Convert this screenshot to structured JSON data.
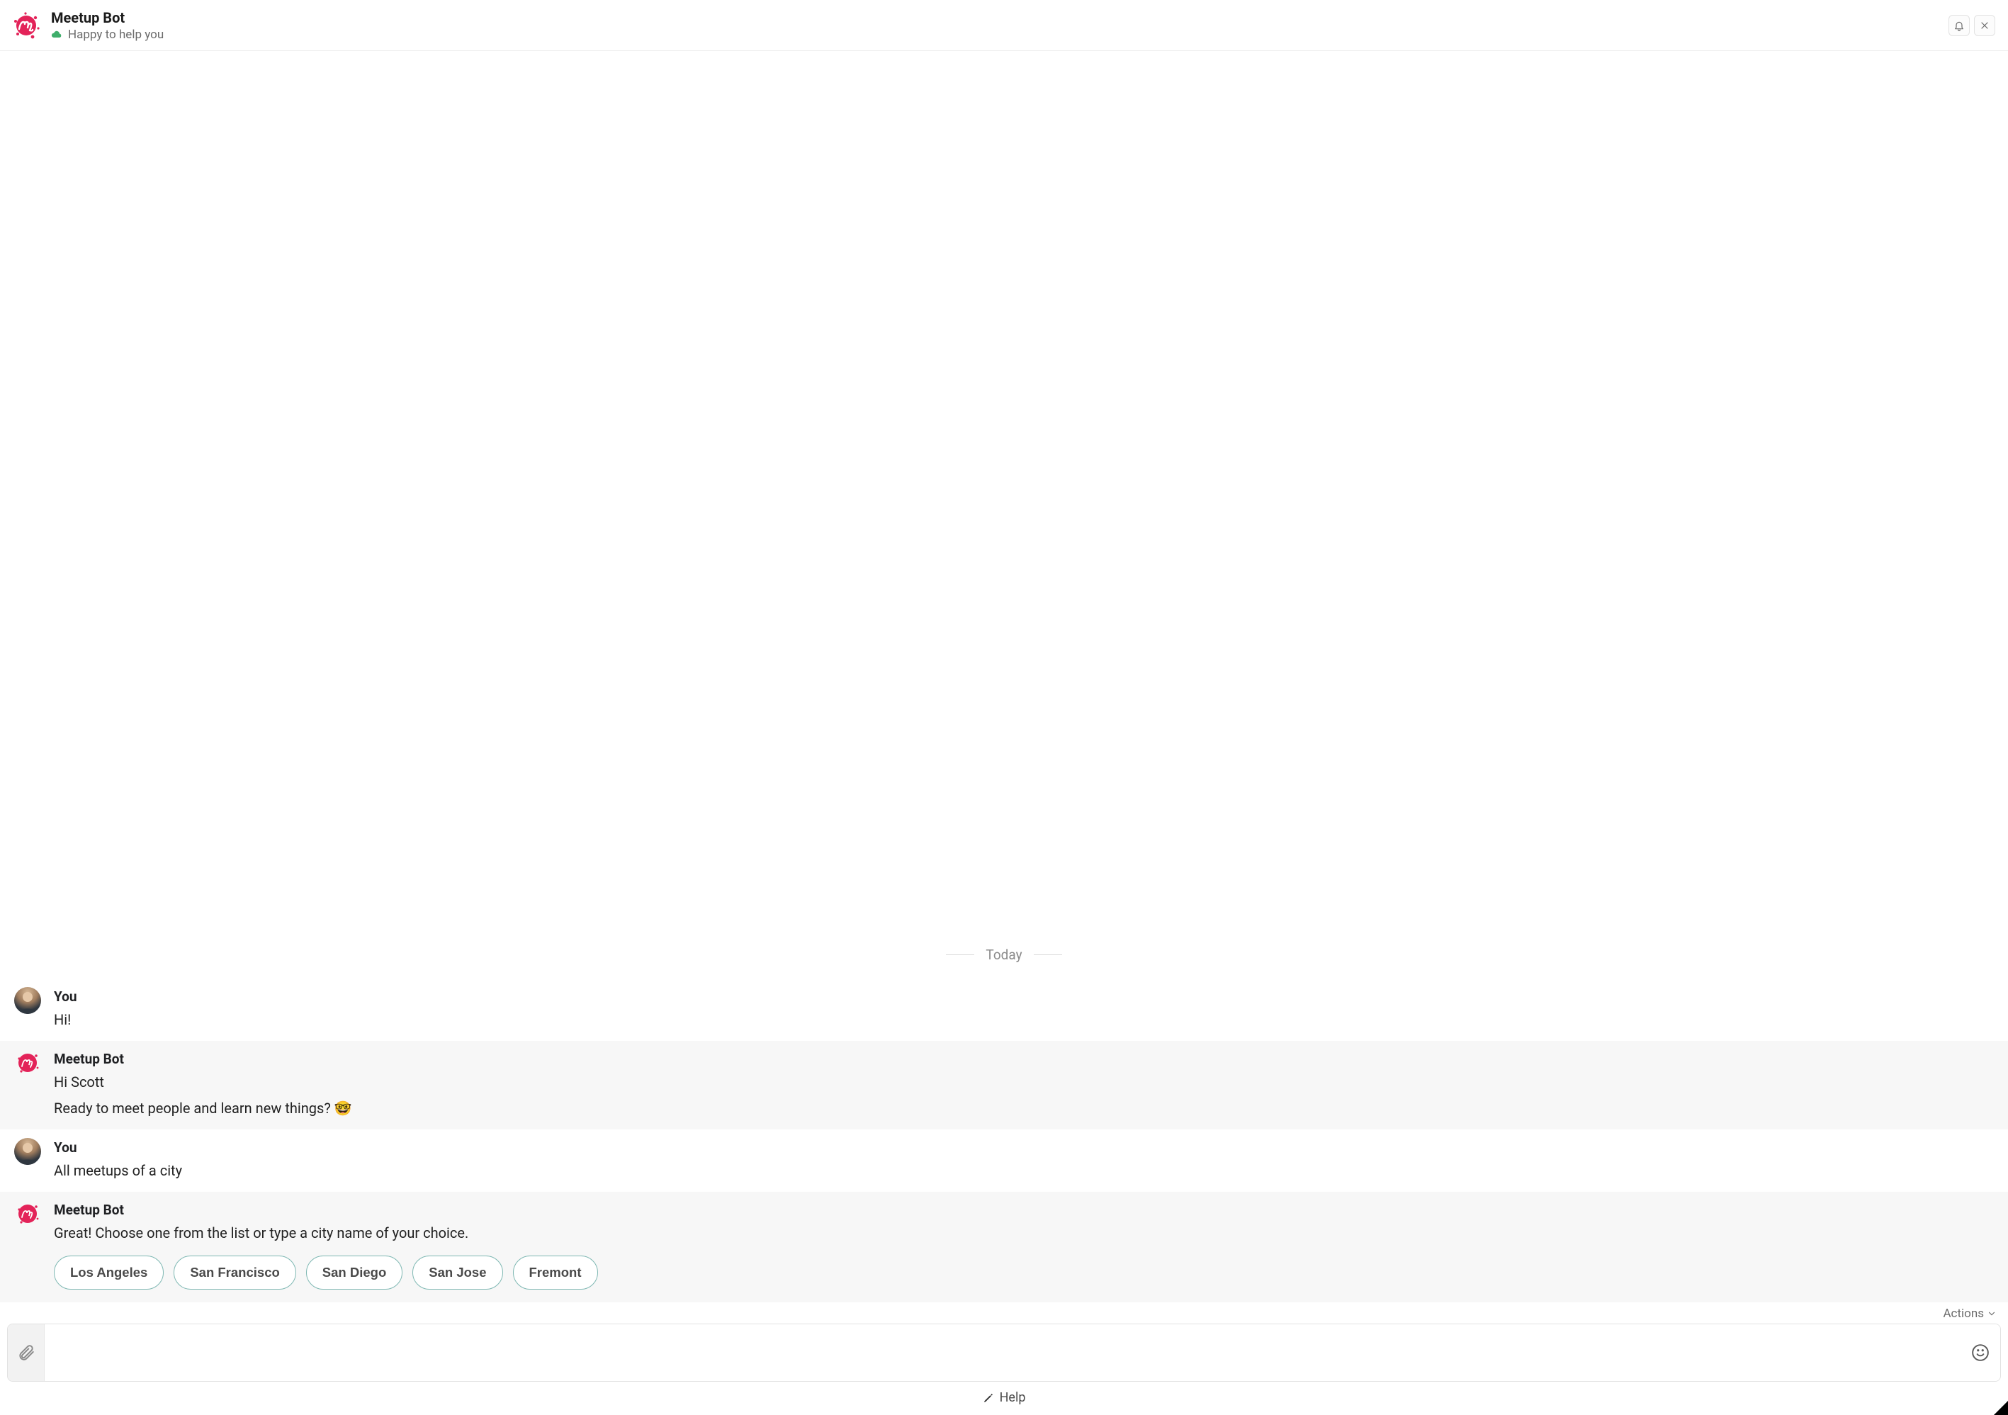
{
  "header": {
    "title": "Meetup Bot",
    "subtitle": "Happy to help you"
  },
  "date_separator": "Today",
  "actions_label": "Actions",
  "help_label": "Help",
  "messages": [
    {
      "sender": "You",
      "kind": "user",
      "lines": [
        "Hi!"
      ]
    },
    {
      "sender": "Meetup Bot",
      "kind": "bot",
      "lines": [
        "Hi Scott",
        "Ready to meet people and learn new things? 🤓"
      ]
    },
    {
      "sender": "You",
      "kind": "user",
      "lines": [
        "All meetups of a city"
      ]
    },
    {
      "sender": "Meetup Bot",
      "kind": "bot",
      "lines": [
        "Great! Choose one from the list or type a city name of your choice."
      ],
      "chips": [
        "Los Angeles",
        "San Francisco",
        "San Diego",
        "San Jose",
        "Fremont"
      ]
    }
  ],
  "composer": {
    "placeholder": ""
  },
  "icons": {
    "status": "cloud-online-icon",
    "bell": "bell-icon",
    "close": "close-icon",
    "attach": "paperclip-icon",
    "emoji": "smiley-icon",
    "pencil": "pencil-icon",
    "chevron": "chevron-down-icon"
  },
  "colors": {
    "brand": "#e32359",
    "chip_border": "#7fb8b3",
    "status_green": "#3fae6b"
  }
}
